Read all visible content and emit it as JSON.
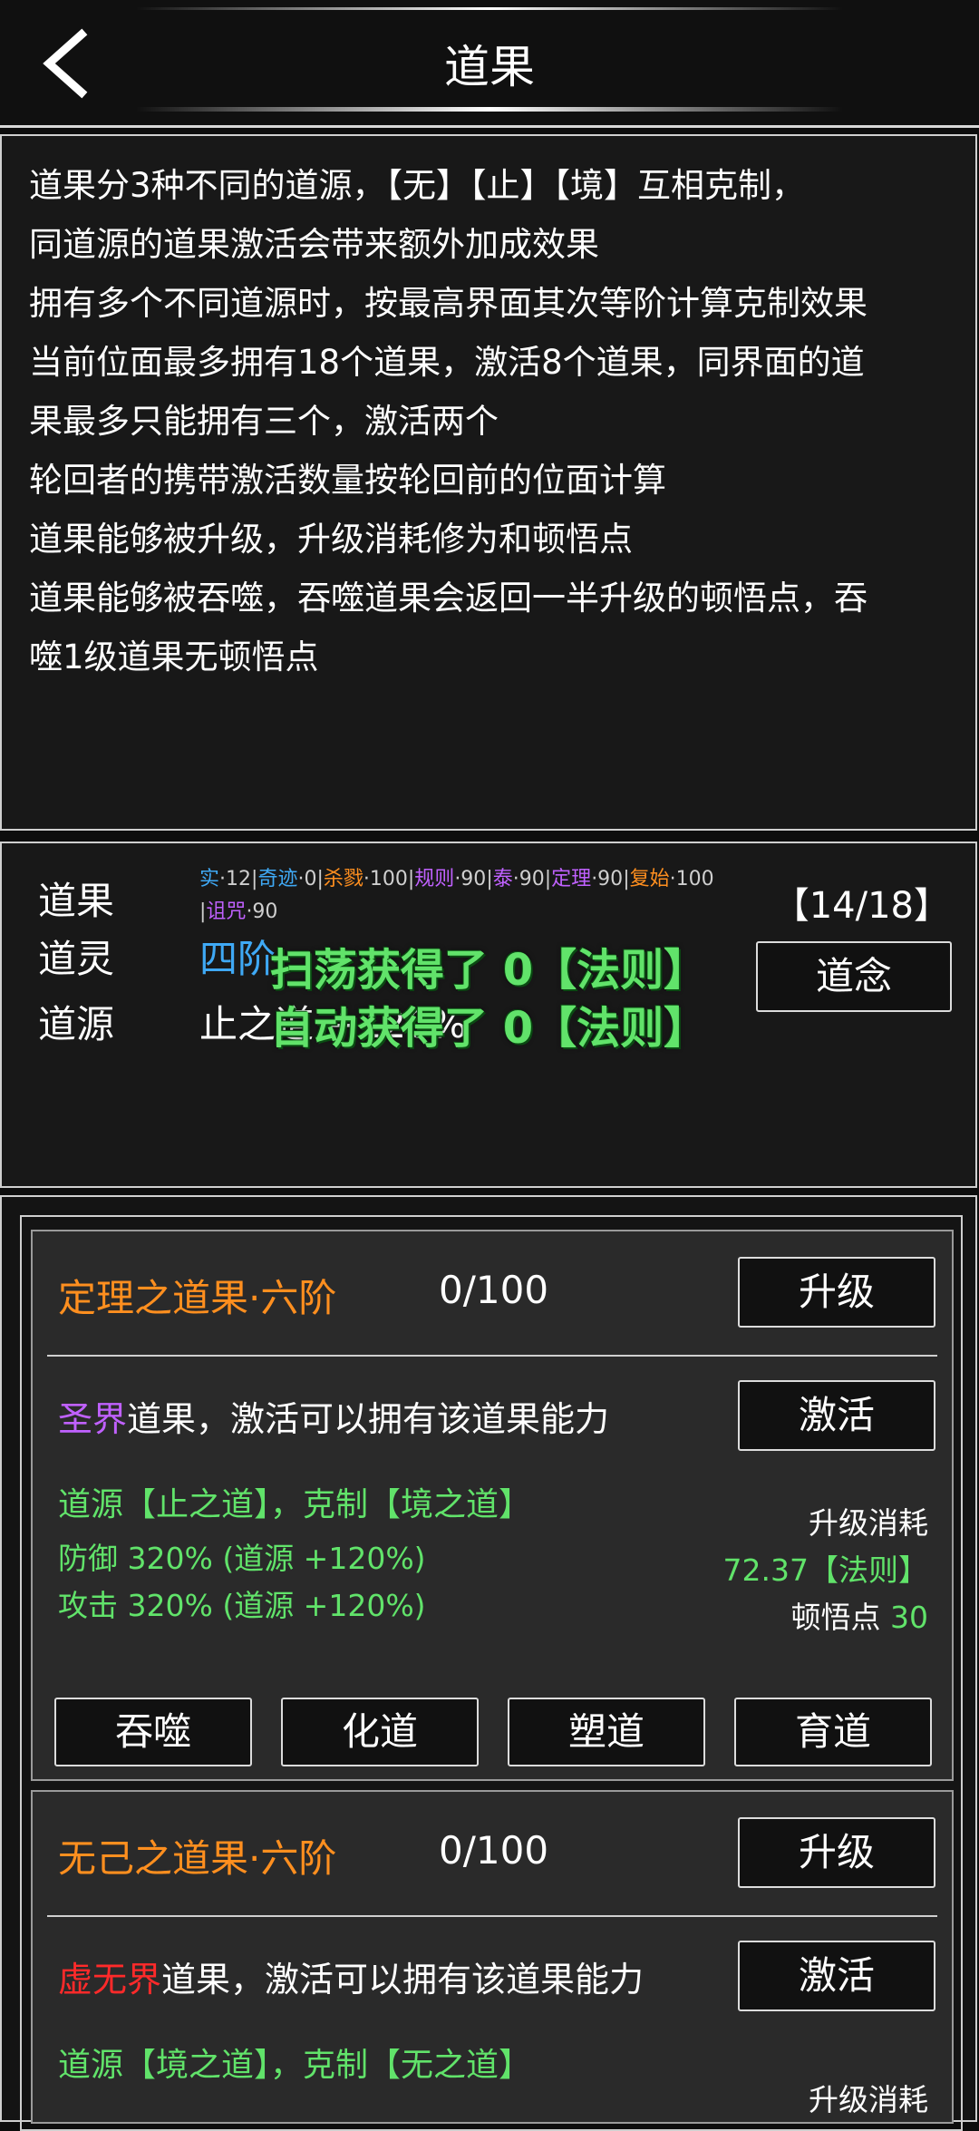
{
  "header": {
    "title": "道果"
  },
  "description": [
    "道果分3种不同的道源，【无】【止】【境】互相克制，",
    "同道源的道果激活会带来额外加成效果",
    "拥有多个不同道源时，按最高界面其次等阶计算克制效果",
    "当前位面最多拥有18个道果，激活8个道果，同界面的道",
    "果最多只能拥有三个，激活两个",
    "轮回者的携带激活数量按轮回前的位面计算",
    "道果能够被升级，升级消耗修为和顿悟点",
    "道果能够被吞噬，吞噬道果会返回一半升级的顿悟点，吞",
    "噬1级道果无顿悟点"
  ],
  "info": {
    "daoguo_label": "道果",
    "stats": [
      {
        "name": "实",
        "value": "12",
        "color": "#3fa9f5"
      },
      {
        "name": "奇迹",
        "value": "0",
        "color": "#3fa9f5"
      },
      {
        "name": "杀戮",
        "value": "100",
        "color": "#ff8f1f"
      },
      {
        "name": "规则",
        "value": "90",
        "color": "#c061ff"
      },
      {
        "name": "泰",
        "value": "90",
        "color": "#c061ff"
      },
      {
        "name": "定理",
        "value": "90",
        "color": "#c061ff"
      },
      {
        "name": "复始",
        "value": "100",
        "color": "#ff8f1f"
      },
      {
        "name": "诅咒",
        "value": "90",
        "color": "#c061ff"
      }
    ],
    "count": "【14/18】",
    "daoling_label": "道灵",
    "daoling_value": "四阶",
    "daonian_button": "道念",
    "daoyuan_label": "道源",
    "daoyuan_value": "止之道 +120%",
    "toast1": "扫荡获得了 0【法则】",
    "toast2": "自动获得了 0【法则】"
  },
  "cards": [
    {
      "name": "定理之道果·六阶",
      "progress": "0/100",
      "upgrade_button": "升级",
      "realm": "圣界",
      "realm_color": "#c061ff",
      "desc_suffix": "道果，激活可以拥有该道果能力",
      "activate_button": "激活",
      "source": "道源【止之道】，克制【境之道】",
      "bonus1": "防御 320% (道源 +120%)",
      "bonus2": "攻击 320% (道源 +120%)",
      "cost_label": "升级消耗",
      "cost_law": "72.37【法则】",
      "cost_insight_label": "顿悟点",
      "cost_insight_value": "30",
      "actions": [
        "吞噬",
        "化道",
        "塑道",
        "育道"
      ]
    },
    {
      "name": "无己之道果·六阶",
      "progress": "0/100",
      "upgrade_button": "升级",
      "realm": "虚无界",
      "realm_color": "#ff2a2a",
      "desc_suffix": "道果，激活可以拥有该道果能力",
      "activate_button": "激活",
      "source": "道源【境之道】，克制【无之道】",
      "cost_label": "升级消耗"
    }
  ]
}
